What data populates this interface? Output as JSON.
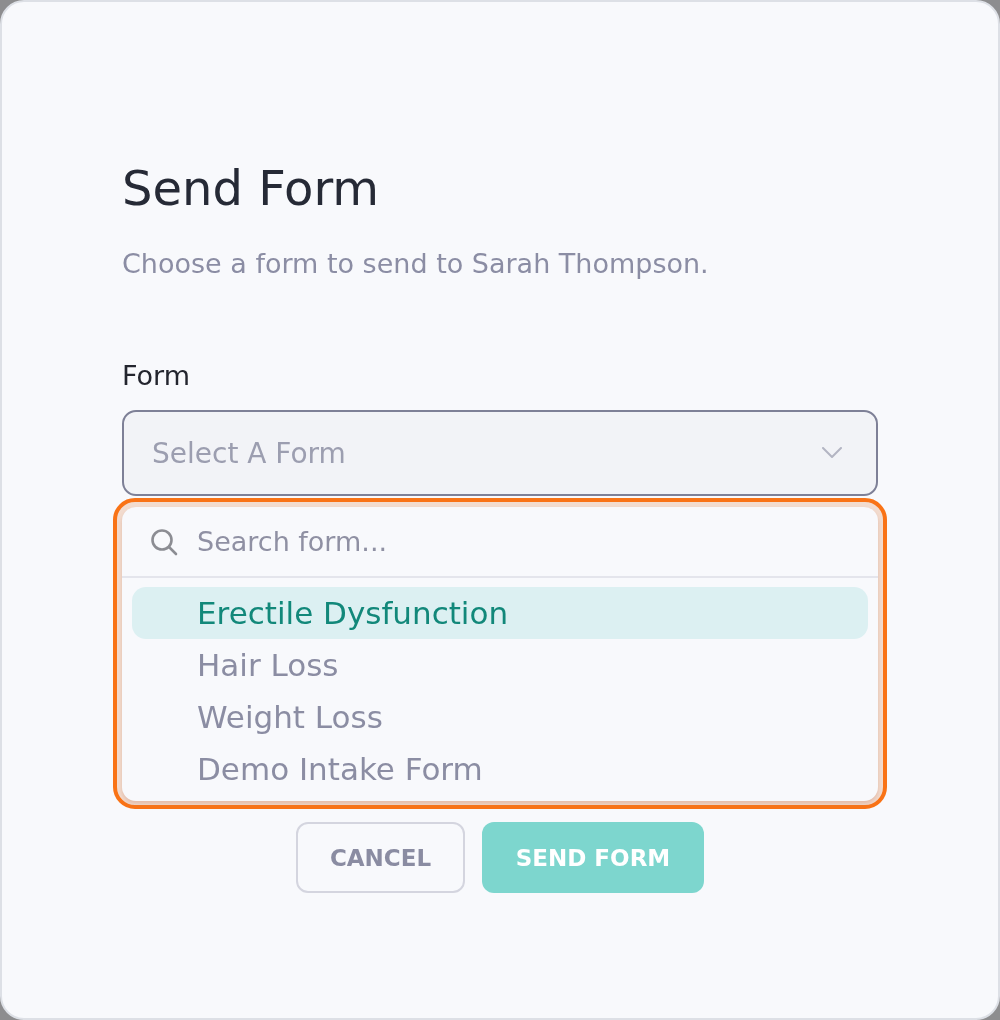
{
  "dialog": {
    "title": "Send Form",
    "subtitle": "Choose a form to send to Sarah Thompson."
  },
  "form_field": {
    "label": "Form",
    "placeholder": "Select A Form"
  },
  "dropdown": {
    "highlighted": true,
    "search": {
      "placeholder": "Search form..."
    },
    "options": [
      {
        "label": "Erectile Dysfunction",
        "selected": true
      },
      {
        "label": "Hair Loss",
        "selected": false
      },
      {
        "label": "Weight Loss",
        "selected": false
      },
      {
        "label": "Demo Intake Form",
        "selected": false
      }
    ]
  },
  "buttons": [
    {
      "label": "CANCEL",
      "kind": "secondary"
    },
    {
      "label": "SEND FORM",
      "kind": "primary"
    }
  ]
}
